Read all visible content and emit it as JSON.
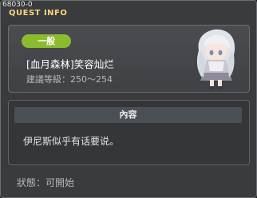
{
  "quest": {
    "id": "68030-0",
    "window_title": "QUEST INFO",
    "category": "一般",
    "name": "[血月森林]笑容灿烂",
    "recommended_level": "建議等級：250～254",
    "content_header": "內容",
    "content_text": "伊尼斯似乎有话要说。",
    "status": "狀態：可開始"
  },
  "icons": {
    "close": "close-icon",
    "npc_portrait": "npc-portrait-image"
  },
  "colors": {
    "title": "#fbd77c",
    "badge": "#8bbb2e",
    "panel": "#3a3b3d"
  }
}
